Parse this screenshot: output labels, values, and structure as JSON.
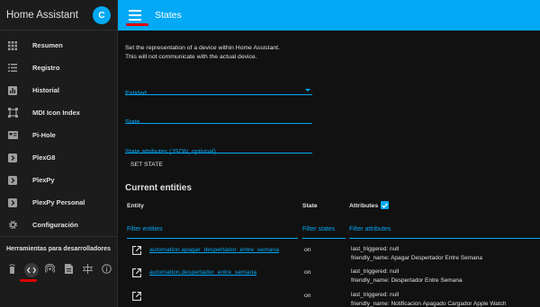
{
  "sidebar": {
    "title": "Home Assistant",
    "avatar_initial": "C",
    "items": [
      {
        "label": "Resumen",
        "icon": "grid-icon"
      },
      {
        "label": "Registro",
        "icon": "list-icon"
      },
      {
        "label": "Historial",
        "icon": "chart-icon"
      },
      {
        "label": "MDI Icon Index",
        "icon": "crop-icon"
      },
      {
        "label": "Pi-Hole",
        "icon": "card-icon"
      },
      {
        "label": "PlexG8",
        "icon": "chevron-right-icon"
      },
      {
        "label": "PlexPy",
        "icon": "chevron-right-icon"
      },
      {
        "label": "PlexPy Personal",
        "icon": "chevron-right-icon"
      },
      {
        "label": "Configuración",
        "icon": "gear-icon"
      }
    ],
    "dev_tools_title": "Herramientas para desarrolladores",
    "dev_tools": [
      "remote-icon",
      "code-icon",
      "broadcast-icon",
      "file-icon",
      "template-icon",
      "info-icon"
    ]
  },
  "header": {
    "title": "States"
  },
  "main": {
    "description_line1": "Set the representation of a device within Home Assistant.",
    "description_line2": "This will not communicate with the actual device.",
    "entity_label": "Entidad",
    "state_label": "State",
    "attributes_label": "State attributes (JSON, optional)",
    "set_state_label": "SET STATE",
    "current_entities_title": "Current entities",
    "columns": {
      "entity": "Entity",
      "state": "State",
      "attributes": "Attributes"
    },
    "filters": {
      "entities": "Filter entities",
      "states": "Filter states",
      "attributes": "Filter attributes"
    },
    "rows": [
      {
        "entity": "automation.apagar_despertador_entre_semana",
        "state": "on",
        "attr1": "last_triggered: null",
        "attr2": "friendly_name: Apagar Despertador Entre Semana"
      },
      {
        "entity": "automation.despertador_entre_semana",
        "state": "on",
        "attr1": "last_triggered: null",
        "attr2": "friendly_name: Despertador Entre Semana"
      },
      {
        "entity": "",
        "state": "on",
        "attr1": "last_triggered: null",
        "attr2": "friendly_name: Notificacion Apagado Cargador Apple Watch"
      }
    ]
  },
  "colors": {
    "accent": "#03a9f4",
    "mark": "#dd0000"
  }
}
